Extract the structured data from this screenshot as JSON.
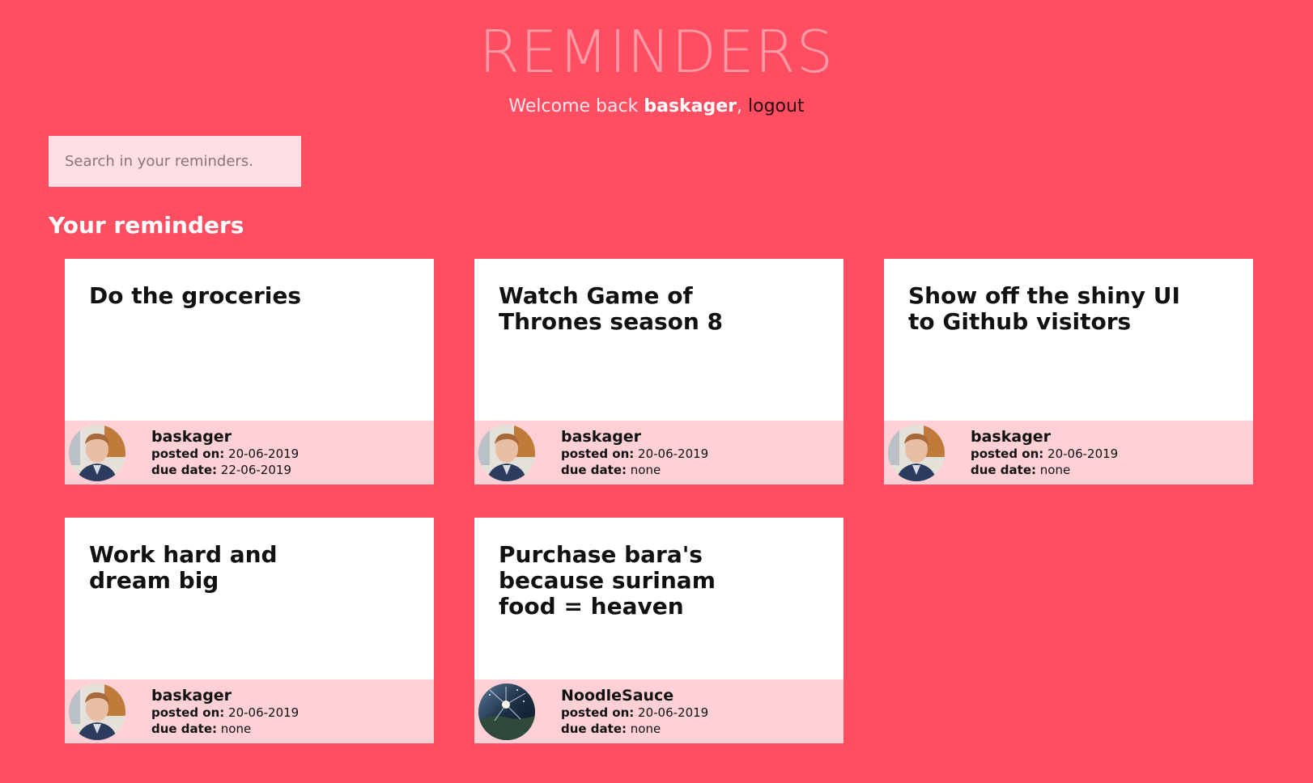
{
  "header": {
    "title": "REMINDERS",
    "welcome_prefix": "Welcome back",
    "username": "baskager",
    "separator": ",",
    "logout_label": "logout"
  },
  "search": {
    "placeholder": "Search in your reminders."
  },
  "section_title": "Your reminders",
  "labels": {
    "posted_on": "posted on:",
    "due_date": "due date:"
  },
  "colors": {
    "background": "#ff4d62",
    "card": "#ffffff",
    "card_footer": "#ffd0d6",
    "search_bg": "#ffdfe3"
  },
  "reminders": [
    {
      "title": "Do the groceries",
      "author": "baskager",
      "posted_on": "20-06-2019",
      "due_date": "22-06-2019",
      "avatar": "user-avatar"
    },
    {
      "title": "Watch Game of Thrones season 8",
      "author": "baskager",
      "posted_on": "20-06-2019",
      "due_date": "none",
      "avatar": "user-avatar"
    },
    {
      "title": "Show off the shiny UI to Github visitors",
      "author": "baskager",
      "posted_on": "20-06-2019",
      "due_date": "none",
      "avatar": "user-avatar"
    },
    {
      "title": "Work hard and dream big",
      "author": "baskager",
      "posted_on": "20-06-2019",
      "due_date": "none",
      "avatar": "user-avatar"
    },
    {
      "title": "Purchase bara's because surinam food = heaven",
      "author": "NoodleSauce",
      "posted_on": "20-06-2019",
      "due_date": "none",
      "avatar": "noodlesauce-avatar"
    }
  ]
}
